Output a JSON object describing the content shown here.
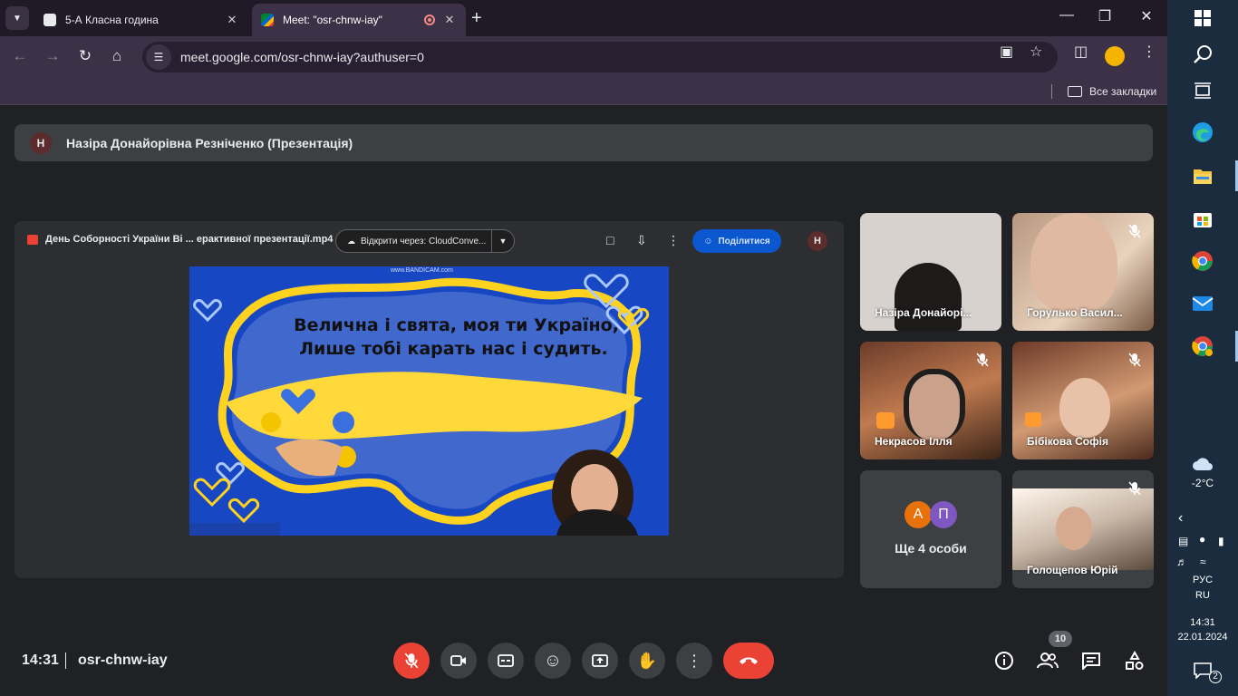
{
  "browser": {
    "tabs": [
      {
        "title": "5-А Класна година",
        "active": false
      },
      {
        "title": "Meet: \"osr-chnw-iay\"",
        "active": true
      }
    ],
    "url": "meet.google.com/osr-chnw-iay?authuser=0",
    "bookmarks_folder": "Все закладки"
  },
  "meet": {
    "presenter_initial": "Н",
    "presenter_label": "Назіра Донайорівна Резніченко (Презентація)",
    "document": {
      "filename": "День Соборності України Ві ... ерактивної презентації.mp4",
      "open_with": "Відкрити через: CloudConve...",
      "share_label": "Поділитися",
      "owner_initial": "Н"
    },
    "slide": {
      "watermark": "www.BANDICAM.com",
      "line1": "Величнa і святa, моя ти Україно,",
      "line2": "Лише тобі карать нас  і  судить."
    },
    "participants": [
      {
        "name": "Назіра Донайорі...",
        "muted": false
      },
      {
        "name": "Горулько Васил...",
        "muted": true
      },
      {
        "name": "Некрасов Ілля",
        "muted": true
      },
      {
        "name": "Бібікова Софія",
        "muted": true
      },
      {
        "name": "Голощепов Юрій",
        "muted": true
      }
    ],
    "more": {
      "avatars": [
        {
          "letter": "А",
          "color": "#e8710a"
        },
        {
          "letter": "П",
          "color": "#7e57c2"
        }
      ],
      "label": "Ще 4 особи"
    },
    "time": "14:31",
    "code": "osr-chnw-iay",
    "participant_count": "10"
  },
  "taskbar": {
    "weather": "-2°C",
    "lang_top": "РУС",
    "lang_bottom": "RU",
    "time": "14:31",
    "date": "22.01.2024",
    "notifications": "2"
  },
  "colors": {
    "meet_bg": "#202124",
    "tile_bg": "#3c4043",
    "danger": "#ea4335",
    "share_blue": "#0b57d0",
    "chrome_purple": "#3c3147"
  }
}
